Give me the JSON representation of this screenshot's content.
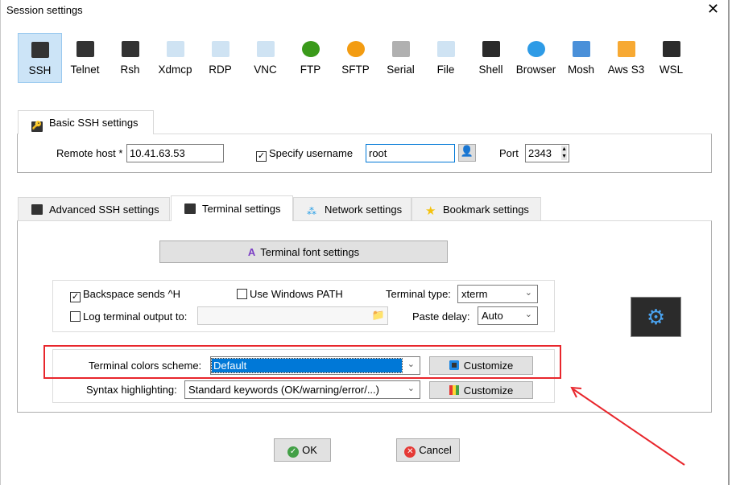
{
  "window": {
    "title": "Session settings",
    "close_icon": "close-icon"
  },
  "protocols": [
    {
      "label": "SSH",
      "icon": "key-icon",
      "color": "#f4b400",
      "bg": "#333",
      "selected": true
    },
    {
      "label": "Telnet",
      "icon": "gem-icon",
      "color": "#9b4fd6",
      "bg": "#333"
    },
    {
      "label": "Rsh",
      "icon": "gears-icon",
      "color": "#e8731a",
      "bg": "#333"
    },
    {
      "label": "Xdmcp",
      "icon": "x-monitor-icon",
      "color": "#000",
      "bg": "#cfe3f3"
    },
    {
      "label": "RDP",
      "icon": "windows-monitor-icon",
      "color": "#1e88e5",
      "bg": "#cfe3f3"
    },
    {
      "label": "VNC",
      "icon": "vnc-monitor-icon",
      "color": "#d32f2f",
      "bg": "#cfe3f3"
    },
    {
      "label": "FTP",
      "icon": "green-globe-icon",
      "color": "#3a9a1a",
      "bg": "#3a9a1a"
    },
    {
      "label": "SFTP",
      "icon": "orange-globe-icon",
      "color": "#f39c12",
      "bg": "#f39c12"
    },
    {
      "label": "Serial",
      "icon": "plug-icon",
      "color": "#888",
      "bg": "#b0b0b0"
    },
    {
      "label": "File",
      "icon": "file-monitor-icon",
      "color": "#3a9a1a",
      "bg": "#cfe3f3"
    },
    {
      "label": "Shell",
      "icon": "terminal-icon",
      "color": "#fff",
      "bg": "#2b2b2b"
    },
    {
      "label": "Browser",
      "icon": "globe-icon",
      "color": "#4caf50",
      "bg": "#2e9be6"
    },
    {
      "label": "Mosh",
      "icon": "satellite-dish-icon",
      "color": "#1e88e5",
      "bg": "#4a90d9"
    },
    {
      "label": "Aws S3",
      "icon": "cubes-icon",
      "color": "#f7a933",
      "bg": "#f7a933"
    },
    {
      "label": "WSL",
      "icon": "windows-icon",
      "color": "#2e9be6",
      "bg": "#2b2b2b"
    }
  ],
  "basic": {
    "tab_label": "Basic SSH settings",
    "remote_host_label": "Remote host *",
    "remote_host_value": "10.41.63.53",
    "specify_username_label": "Specify username",
    "specify_username_checked": true,
    "username_value": "root",
    "port_label": "Port",
    "port_value": "2343"
  },
  "tabs": [
    {
      "label": "Advanced SSH settings",
      "icon": "key-icon"
    },
    {
      "label": "Terminal settings",
      "icon": "gear-icon",
      "selected": true
    },
    {
      "label": "Network settings",
      "icon": "network-icon"
    },
    {
      "label": "Bookmark settings",
      "icon": "star-icon"
    }
  ],
  "terminal": {
    "font_button": "Terminal font settings",
    "backspace_label": "Backspace sends ^H",
    "backspace_checked": true,
    "windows_path_label": "Use Windows PATH",
    "windows_path_checked": false,
    "terminal_type_label": "Terminal type:",
    "terminal_type_value": "xterm",
    "log_label": "Log terminal output to:",
    "log_checked": false,
    "log_value": "",
    "paste_delay_label": "Paste delay:",
    "paste_delay_value": "Auto",
    "colors_label": "Terminal colors scheme:",
    "colors_value": "Default",
    "customize_label": "Customize",
    "syntax_label": "Syntax highlighting:",
    "syntax_value": "Standard keywords (OK/warning/error/...)",
    "customize2_label": "Customize"
  },
  "annotation": {
    "highlight_color": "#e8262c"
  },
  "footer": {
    "ok_label": "OK",
    "cancel_label": "Cancel"
  }
}
